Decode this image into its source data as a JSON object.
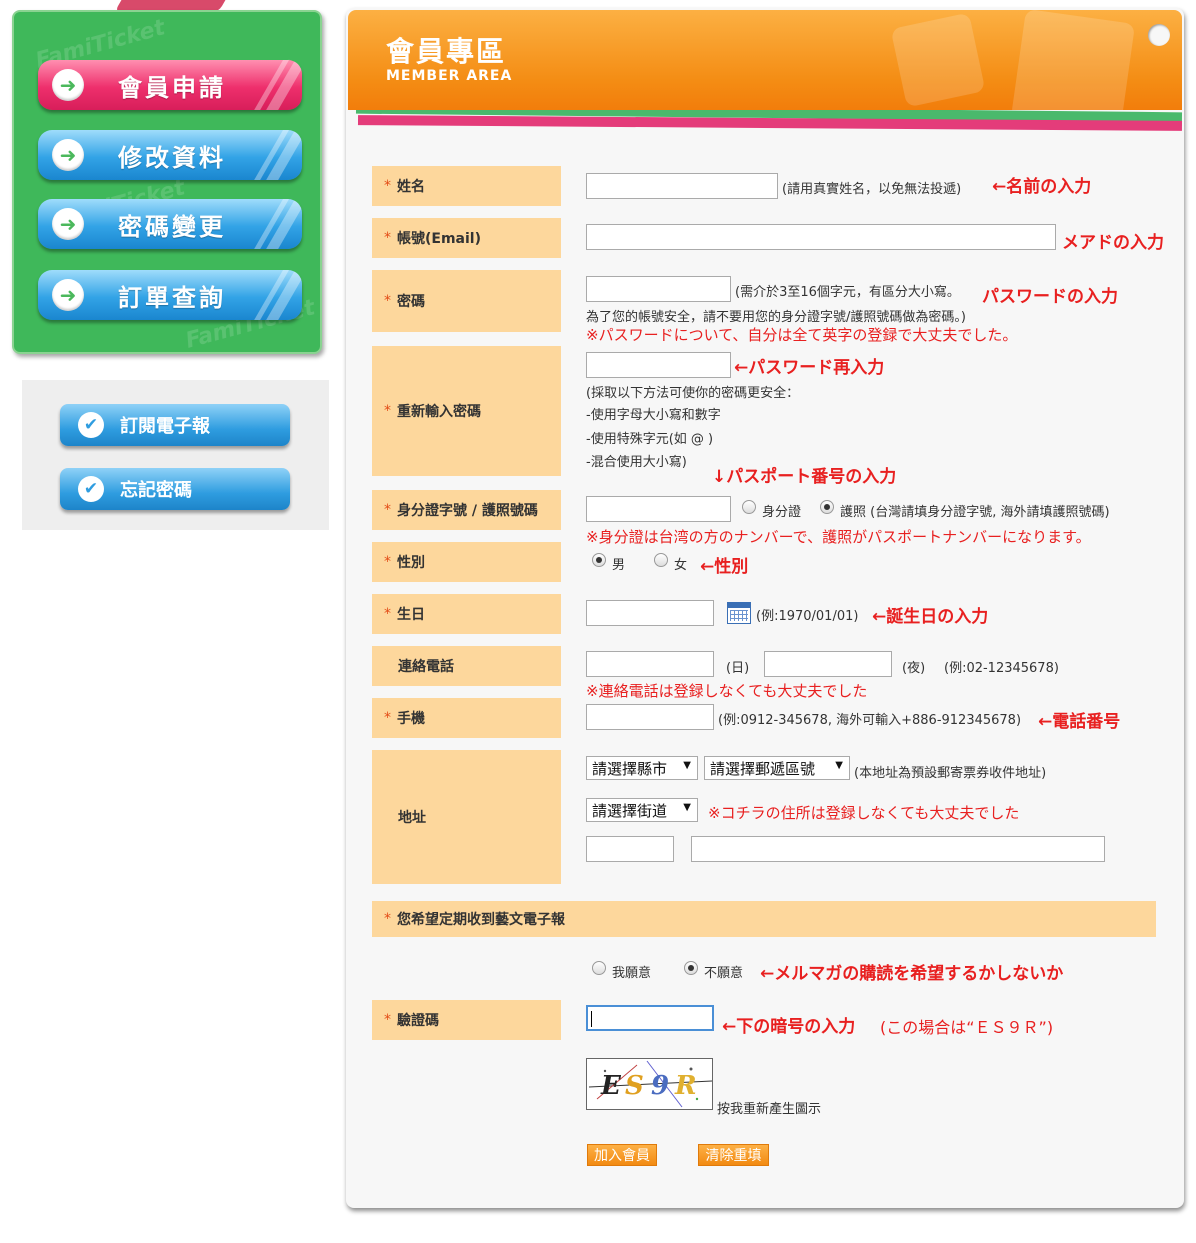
{
  "sidebar": {
    "menu": [
      {
        "label": "會員申請",
        "active": true
      },
      {
        "label": "修改資料",
        "active": false
      },
      {
        "label": "密碼變更",
        "active": false
      },
      {
        "label": "訂單查詢",
        "active": false
      }
    ],
    "sub_links": [
      "訂閱電子報",
      "忘記密碼"
    ],
    "watermark": "FamiTicket"
  },
  "header": {
    "title": "會員專區",
    "subtitle": "MEMBER AREA"
  },
  "form": {
    "name": {
      "label": "姓名",
      "hint": "(請用真實姓名，以免無法投遞)",
      "note": "←名前の入力"
    },
    "email": {
      "label": "帳號(Email)",
      "note": "メアドの入力"
    },
    "password": {
      "label": "密碼",
      "hint": "(需介於3至16個字元，有區分大小寫。",
      "note": "パスワードの入力",
      "hint2": "為了您的帳號安全，請不要用您的身分證字號/護照號碼做為密碼。)",
      "note2": "※パスワードについて、自分は全て英字の登録で大丈夫でした。"
    },
    "password_confirm": {
      "label": "重新輸入密碼",
      "note": "←パスワード再入力",
      "tips": [
        "(採取以下方法可使你的密碼更安全：",
        "-使用字母大小寫和數字",
        "-使用特殊字元(如 @ )",
        "-混合使用大小寫)"
      ],
      "note2": "↓パスポート番号の入力"
    },
    "id": {
      "label": "身分證字號 / 護照號碼",
      "option_id": "身分證",
      "option_passport": "護照 (台灣請填身分證字號, 海外請填護照號碼)",
      "selected": "passport",
      "note": "※身分證は台湾の方のナンバーで、護照がパスポートナンバーになります。"
    },
    "gender": {
      "label": "性別",
      "male": "男",
      "female": "女",
      "selected": "male",
      "note": "←性別"
    },
    "birthday": {
      "label": "生日",
      "hint": "(例:1970/01/01)",
      "note": "←誕生日の入力",
      "icon": "calendar-icon"
    },
    "phone": {
      "label": "連絡電話",
      "day": "(日)",
      "night": "(夜)",
      "example": "(例:02-12345678)",
      "note": "※連絡電話は登録しなくても大丈夫でした"
    },
    "mobile": {
      "label": "手機",
      "hint": "(例:0912-345678, 海外可輸入+886-912345678)",
      "note": "←電話番号"
    },
    "address": {
      "label": "地址",
      "city": "請選擇縣市",
      "zip": "請選擇郵遞區號",
      "hint": "(本地址為預設郵寄票券收件地址)",
      "street": "請選擇街道",
      "note": "※コチラの住所は登録しなくても大丈夫でした"
    },
    "newsletter": {
      "label": "您希望定期收到藝文電子報",
      "yes": "我願意",
      "no": "不願意",
      "selected": "no",
      "note": "←メルマガの購読を希望するかしないか"
    },
    "captcha": {
      "label": "驗證碼",
      "note": "←下の暗号の入力",
      "note_small": "(この場合は“ＥＳ９Ｒ”)",
      "code": [
        "E",
        "S",
        "9",
        "R"
      ],
      "refresh": "按我重新產生圖示"
    },
    "submit": "加入會員",
    "reset": "清除重填"
  },
  "colors": {
    "label_bg": "#fdd79c",
    "header": "#f48d14",
    "annotation": "#e82020",
    "menu_green": "#3fb85a",
    "menu_pink": "#ee2f6c",
    "menu_blue": "#32a3e6"
  }
}
